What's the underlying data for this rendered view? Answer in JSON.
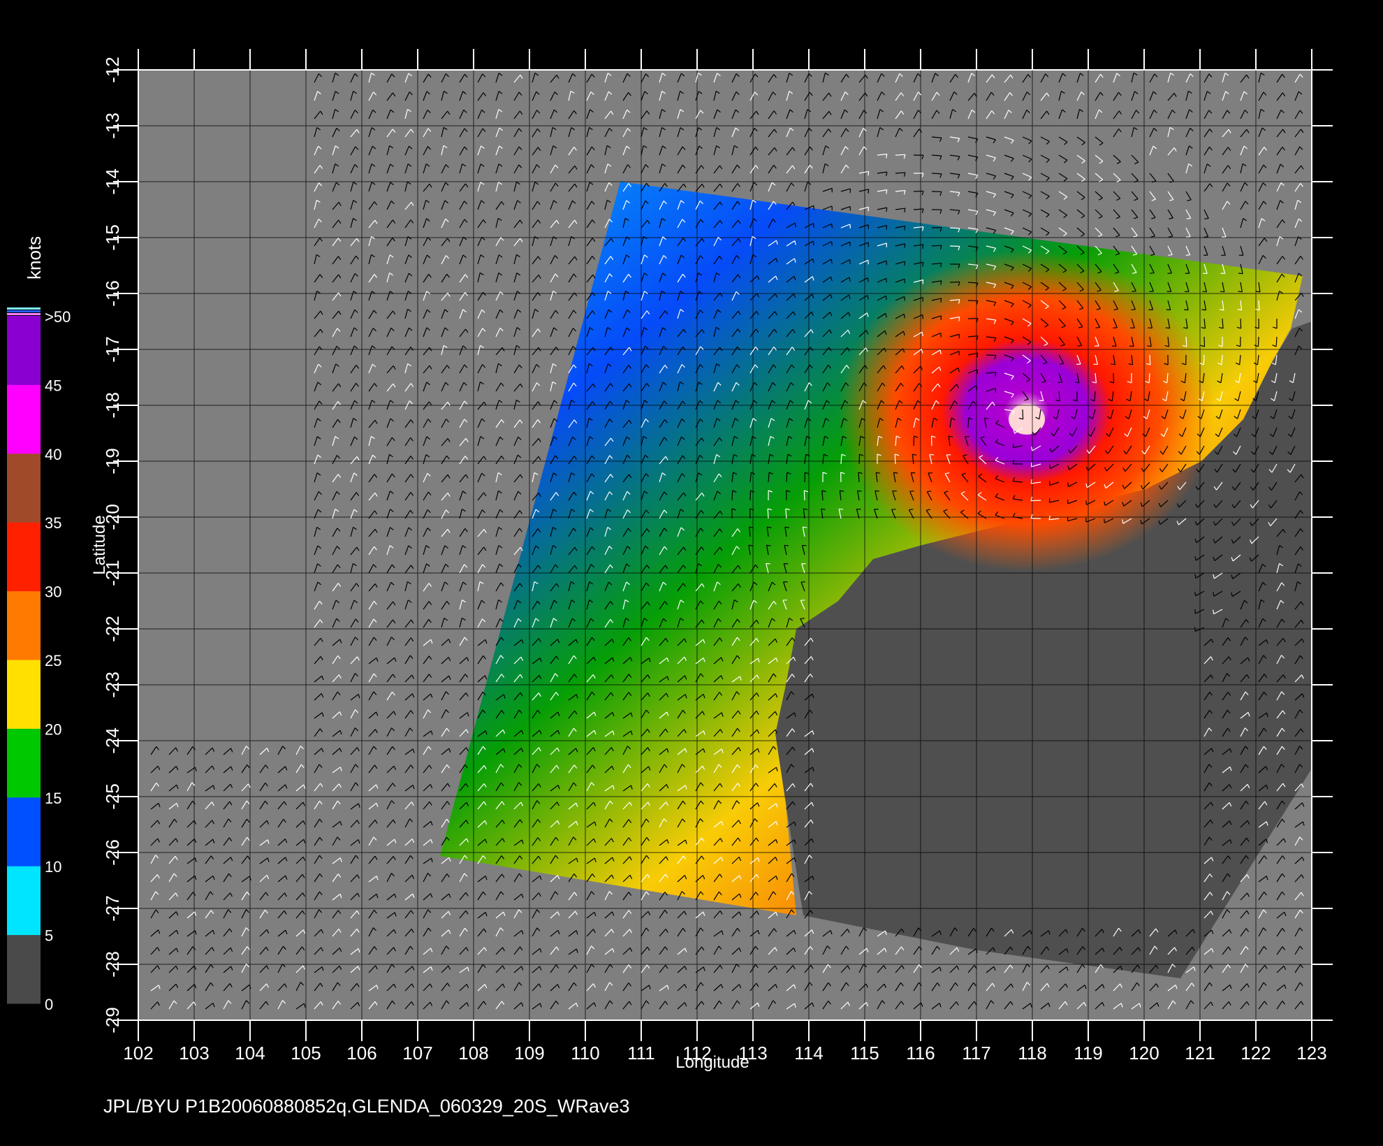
{
  "figure": {
    "footer": "JPL/BYU  P1B20060880852q.GLENDA_060329_20S_WRave3",
    "x_axis_label": "Longitude",
    "y_axis_label": "Latitude"
  },
  "axes": {
    "lon_ticks": [
      "102",
      "103",
      "104",
      "105",
      "106",
      "107",
      "108",
      "109",
      "110",
      "111",
      "112",
      "113",
      "114",
      "115",
      "116",
      "117",
      "118",
      "119",
      "120",
      "121",
      "122",
      "123"
    ],
    "lat_ticks": [
      "-12",
      "-13",
      "-14",
      "-15",
      "-16",
      "-17",
      "-18",
      "-19",
      "-20",
      "-21",
      "-22",
      "-23",
      "-24",
      "-25",
      "-26",
      "-27",
      "-28",
      "-29"
    ],
    "lon_range": [
      102,
      123
    ],
    "lat_range": [
      -29,
      -12
    ]
  },
  "colorbar": {
    "unit": "knots",
    "labels": [
      "0",
      "5",
      "10",
      "15",
      "20",
      "25",
      "30",
      "35",
      "40",
      "45",
      ">50"
    ],
    "colors": [
      "#4a4a4a",
      "#00e5ff",
      "#0050ff",
      "#00c800",
      "#ffe000",
      "#ff7a00",
      "#ff2000",
      "#a04a2a",
      "#ff00ff",
      "#8a00d0"
    ]
  },
  "map": {
    "land_color": "#4f4f4f",
    "background_color": "#7f7f7f",
    "storm_center": {
      "lon": 117.9,
      "lat": -18.2
    },
    "swath_color_scale": [
      "#00aaff",
      "#0040ff",
      "#00a000",
      "#ffd000",
      "#ff6000",
      "#ff1800",
      "#b000d0"
    ]
  }
}
